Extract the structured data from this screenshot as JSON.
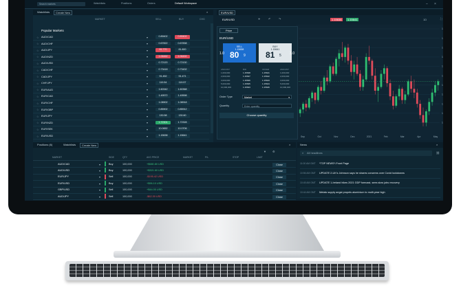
{
  "topnav": {
    "search_placeholder": "Search markets",
    "items": [
      "Watchlists",
      "Positions",
      "Orders",
      "Default Workspace"
    ],
    "active_index": 3
  },
  "watchlist": {
    "tabs": [
      "Watchlists",
      "Create New"
    ],
    "headers": [
      "MARKET",
      "",
      "SELL",
      "BUY",
      "CHG"
    ],
    "section_title": "Popular Markets",
    "rows": [
      {
        "symbol": "AUD/CAD",
        "sell": "0.89402",
        "sell_style": "plain",
        "buy": "0.89402",
        "buy_style": "red"
      },
      {
        "symbol": "AUD/CHF",
        "sell": "0.67822",
        "sell_style": "plain",
        "buy": "0.67838",
        "buy_style": "plain"
      },
      {
        "symbol": "AUD/JPY",
        "sell": "81.770",
        "sell_style": "red",
        "buy": "81.800",
        "buy_style": "plain"
      },
      {
        "symbol": "AUD/NZD",
        "sell": "1.06462",
        "sell_style": "red",
        "buy": "1.06492",
        "buy_style": "red"
      },
      {
        "symbol": "AUD/USD",
        "sell": "0.72120",
        "sell_style": "plain",
        "buy": "0.72130",
        "buy_style": "plain"
      },
      {
        "symbol": "CAD/CHF",
        "sell": "0.73418",
        "sell_style": "plain",
        "buy": "0.73432",
        "buy_style": "plain"
      },
      {
        "symbol": "CAD/JPY",
        "sell": "91.452",
        "sell_style": "plain",
        "buy": "91.471",
        "buy_style": "plain"
      },
      {
        "symbol": "CHF/JPY",
        "sell": "119.54",
        "sell_style": "plain",
        "buy": "119.57",
        "buy_style": "plain"
      },
      {
        "symbol": "EUR/AUD",
        "sell": "1.60342",
        "sell_style": "plain",
        "buy": "1.60368",
        "buy_style": "plain"
      },
      {
        "symbol": "EUR/CAD",
        "sell": "1.49572",
        "sell_style": "plain",
        "buy": "1.49598",
        "buy_style": "plain"
      },
      {
        "symbol": "EUR/CHF",
        "sell": "1.08902",
        "sell_style": "plain",
        "buy": "1.08918",
        "buy_style": "plain"
      },
      {
        "symbol": "EUR/GBP",
        "sell": "0.85902",
        "sell_style": "plain",
        "buy": "0.85912",
        "buy_style": "plain"
      },
      {
        "symbol": "EUR/JPY",
        "sell": "130.58",
        "sell_style": "plain",
        "buy": "130.60",
        "buy_style": "plain"
      },
      {
        "symbol": "EUR/NZD",
        "sell": "1.72301",
        "sell_style": "green",
        "buy": "1.72328",
        "buy_style": "plain"
      },
      {
        "symbol": "EUR/SEK",
        "sell": "10.0652",
        "sell_style": "plain",
        "buy": "10.0706",
        "buy_style": "plain"
      },
      {
        "symbol": "EUR/USD",
        "sell": "1.15638",
        "sell_style": "plain",
        "buy": "1.15641",
        "buy_style": "plain"
      }
    ]
  },
  "ticket": {
    "price_tab": "Price",
    "pair": "EUR/USD",
    "sell_label": "SELL",
    "sell_price": "1.15638",
    "sell_big": "80",
    "sell_small": "9",
    "buy_label": "BUY",
    "buy_price": "1.15641",
    "buy_big": "81",
    "buy_small": "5",
    "spread_left": "1.0",
    "spread_right": "3.0",
    "depth_headers": [
      "AMOUNT",
      "BID",
      "OFFER",
      "AMOUNT"
    ],
    "depth_rows": [
      [
        "1,000,000",
        "1.15638",
        "1.15641",
        "1,000,000"
      ],
      [
        "2,000,000",
        "1.15637",
        "1.15642",
        "2,000,000"
      ],
      [
        "3,000,000",
        "1.15636",
        "1.15643",
        "3,000,000"
      ],
      [
        "5,000,000",
        "1.15635",
        "1.15644",
        "5,000,000"
      ],
      [
        "10,000,000",
        "1.15633",
        "1.15646",
        "10,000,000"
      ]
    ],
    "order_type_label": "Order Type",
    "order_type_value": "Market",
    "quantity_label": "Quantity",
    "quantity_placeholder": "Enter quantity",
    "choose_quantity": "Choose quantity"
  },
  "chart": {
    "tab": "EUR/USD",
    "symbol": "EUR/USD",
    "price_labels": [
      "1.15638",
      "1.15641"
    ],
    "timeframe": "1D",
    "candles": [
      [
        1.14,
        1.143,
        1.138,
        1.142
      ],
      [
        1.142,
        1.146,
        1.14,
        1.145
      ],
      [
        1.145,
        1.147,
        1.141,
        1.143
      ],
      [
        1.143,
        1.149,
        1.142,
        1.148
      ],
      [
        1.148,
        1.152,
        1.146,
        1.151
      ],
      [
        1.151,
        1.15,
        1.145,
        1.147
      ],
      [
        1.147,
        1.155,
        1.146,
        1.154
      ],
      [
        1.154,
        1.157,
        1.15,
        1.152
      ],
      [
        1.152,
        1.16,
        1.151,
        1.159
      ],
      [
        1.159,
        1.163,
        1.155,
        1.157
      ],
      [
        1.157,
        1.166,
        1.156,
        1.165
      ],
      [
        1.165,
        1.167,
        1.16,
        1.161
      ],
      [
        1.161,
        1.17,
        1.16,
        1.169
      ],
      [
        1.169,
        1.174,
        1.165,
        1.172
      ],
      [
        1.172,
        1.178,
        1.168,
        1.17
      ],
      [
        1.17,
        1.176,
        1.167,
        1.175
      ],
      [
        1.175,
        1.177,
        1.166,
        1.168
      ],
      [
        1.168,
        1.171,
        1.16,
        1.162
      ],
      [
        1.162,
        1.168,
        1.158,
        1.166
      ],
      [
        1.166,
        1.17,
        1.16,
        1.161
      ],
      [
        1.161,
        1.163,
        1.152,
        1.154
      ],
      [
        1.154,
        1.16,
        1.152,
        1.158
      ],
      [
        1.158,
        1.172,
        1.157,
        1.17
      ],
      [
        1.17,
        1.176,
        1.166,
        1.168
      ],
      [
        1.168,
        1.169,
        1.158,
        1.16
      ],
      [
        1.16,
        1.164,
        1.15,
        1.152
      ],
      [
        1.152,
        1.156,
        1.146,
        1.154
      ],
      [
        1.154,
        1.163,
        1.153,
        1.161
      ],
      [
        1.161,
        1.166,
        1.158,
        1.164
      ],
      [
        1.164,
        1.165,
        1.154,
        1.156
      ],
      [
        1.156,
        1.158,
        1.147,
        1.149
      ],
      [
        1.149,
        1.152,
        1.142,
        1.144
      ],
      [
        1.144,
        1.15,
        1.143,
        1.149
      ],
      [
        1.149,
        1.155,
        1.147,
        1.153
      ],
      [
        1.153,
        1.154,
        1.145,
        1.147
      ],
      [
        1.147,
        1.152,
        1.145,
        1.15
      ],
      [
        1.15,
        1.158,
        1.149,
        1.157
      ],
      [
        1.157,
        1.16,
        1.151,
        1.153
      ],
      [
        1.153,
        1.158,
        1.148,
        1.151
      ],
      [
        1.151,
        1.153,
        1.143,
        1.145
      ],
      [
        1.145,
        1.147,
        1.137,
        1.139
      ],
      [
        1.139,
        1.143,
        1.133,
        1.135
      ],
      [
        1.135,
        1.142,
        1.133,
        1.141
      ],
      [
        1.141,
        1.148,
        1.139,
        1.146
      ],
      [
        1.146,
        1.153,
        1.144,
        1.151
      ],
      [
        1.151,
        1.157,
        1.149,
        1.155
      ],
      [
        1.155,
        1.158,
        1.152,
        1.157
      ]
    ],
    "x_labels": [
      "Sep",
      "Oct",
      "Nov",
      "Dec",
      "2021",
      "Feb",
      "Mar",
      "Apr",
      "May"
    ],
    "y_labels": [
      "1.1850",
      "1.1800",
      "1.1750",
      "1.1700",
      "1.1650",
      "1.1600",
      "1.1550",
      "1.1500",
      "1.1450",
      "1.1400",
      "1.1350"
    ],
    "ylim": [
      1.13,
      1.185
    ],
    "colors": {
      "up": "#2fbf71",
      "down": "#e04b5a"
    }
  },
  "positions": {
    "tabs": [
      "Positions (6)",
      "Watchlists",
      "Create New"
    ],
    "headers": [
      "MARKET",
      "",
      "SIDE",
      "QTY",
      "AVG PRICE",
      "MARKET",
      "P/L",
      "STOP",
      "LIMIT",
      ""
    ],
    "rows": [
      {
        "market": "AUD/CAD",
        "side": "Buy",
        "qty": "100,000",
        "pl": "+$580.80 USD",
        "pl_color": "#3ac27e",
        "bar": "#2aa86a",
        "close": "Close"
      },
      {
        "market": "AUD/USD",
        "side": "Buy",
        "qty": "100,000",
        "pl": "+$321.60 USD",
        "pl_color": "#3ac27e",
        "bar": "#2aa86a",
        "close": "Close"
      },
      {
        "market": "EUR/JPY",
        "side": "Sell",
        "qty": "100,000",
        "pl": "-$195.42 USD",
        "pl_color": "#e04b5a",
        "bar": "#e04b5a",
        "close": "Close"
      },
      {
        "market": "EUR/USD",
        "side": "Buy",
        "qty": "100,000",
        "pl": "+$96.10 USD",
        "pl_color": "#3ac27e",
        "bar": "#2aa86a",
        "close": "Close"
      },
      {
        "market": "GBP/USD",
        "side": "Sell",
        "qty": "100,000",
        "pl": "+$44.00 USD",
        "pl_color": "#3ac27e",
        "bar": "#2aa86a",
        "close": "Close"
      },
      {
        "market": "AUD/JPY",
        "side": "Sell",
        "qty": "100,000",
        "pl": "-$62.30 USD",
        "pl_color": "#e04b5a",
        "bar": "#e04b5a",
        "close": "Close"
      }
    ]
  },
  "news": {
    "tab": "News",
    "search_placeholder": "All headlines",
    "items": [
      {
        "time": "11:00 AM GMT",
        "headline": "*TOP NEWS*-Front Page"
      },
      {
        "time": "10:56 AM GMT",
        "headline": "UPDATE 2-UK's Johnson says he shares concerns over Covid lockdowns"
      },
      {
        "time": "10:45 AM GMT",
        "headline": "UPDATE 1-Ireland hikes 2021 GDP forecast, sees slow jobs recovery"
      },
      {
        "time": "10:44 AM GMT",
        "headline": "Metals supply angst propels aluminium to multi-year high"
      }
    ]
  }
}
